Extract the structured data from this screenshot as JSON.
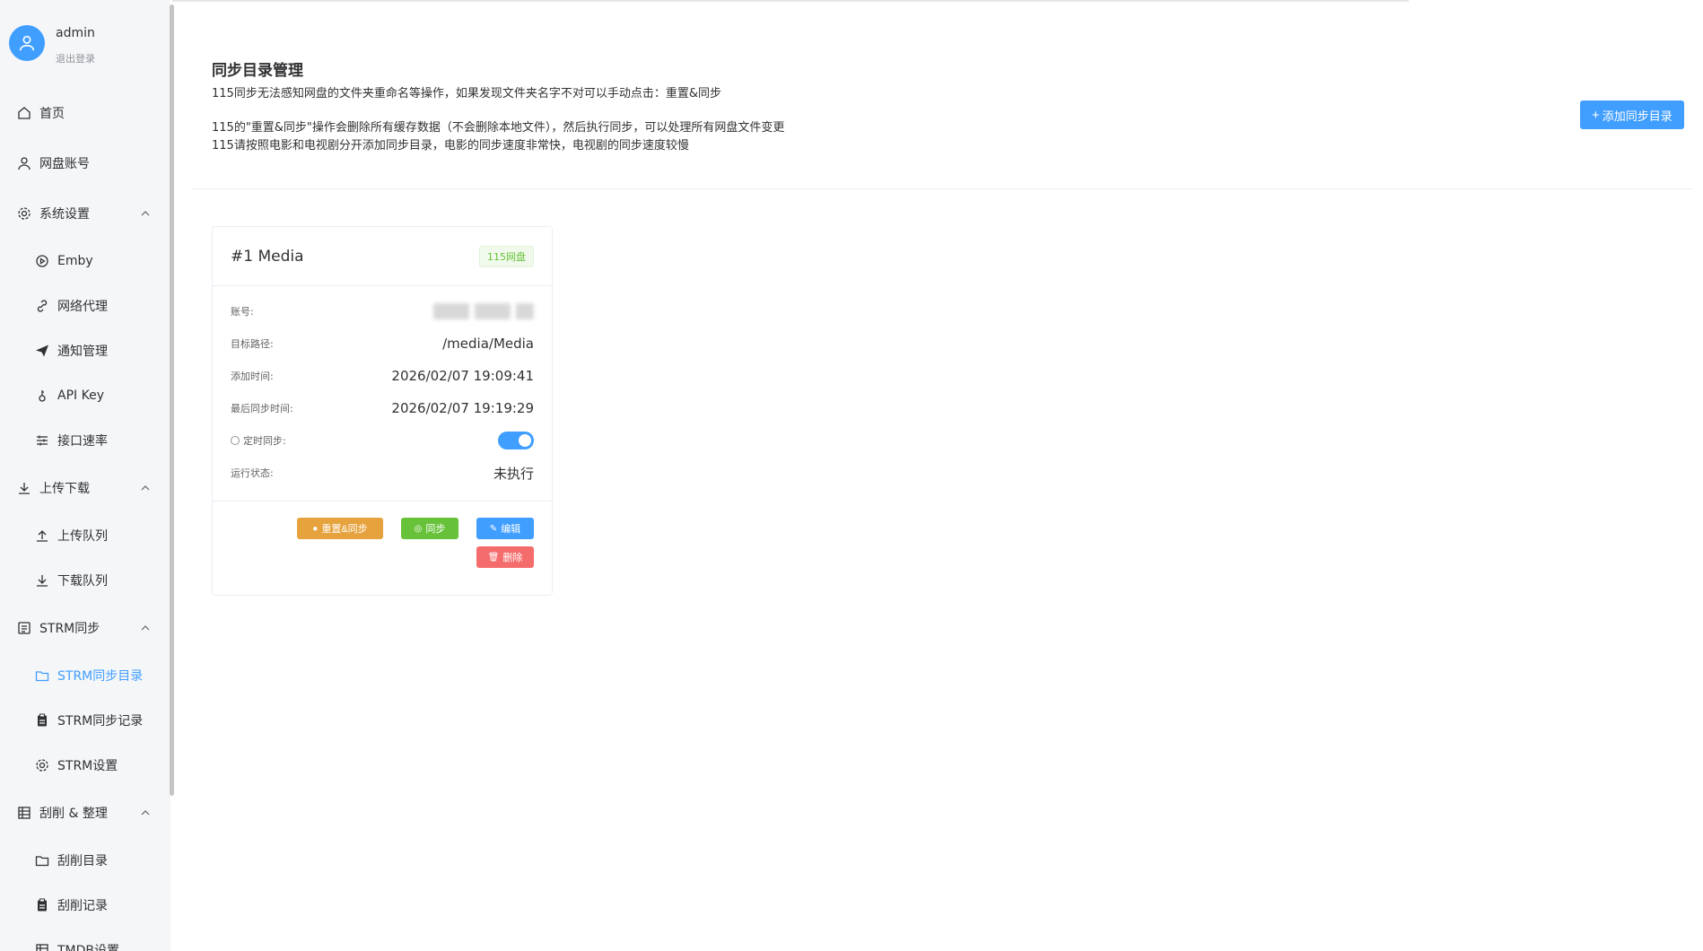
{
  "user": {
    "name": "admin",
    "logout_label": "退出登录"
  },
  "sidebar": {
    "items": [
      {
        "label": "首页",
        "icon": "home-icon",
        "level": 0
      },
      {
        "label": "网盘账号",
        "icon": "user-icon",
        "level": 0
      },
      {
        "label": "系统设置",
        "icon": "gear-icon",
        "level": 0,
        "expanded": true
      },
      {
        "label": "Emby",
        "icon": "play-circle-icon",
        "level": 1
      },
      {
        "label": "网络代理",
        "icon": "link-icon",
        "level": 1
      },
      {
        "label": "通知管理",
        "icon": "send-icon",
        "level": 1
      },
      {
        "label": "API Key",
        "icon": "key-icon",
        "level": 1
      },
      {
        "label": "接口速率",
        "icon": "sliders-icon",
        "level": 1
      },
      {
        "label": "上传下载",
        "icon": "download-icon",
        "level": 0,
        "expanded": true
      },
      {
        "label": "上传队列",
        "icon": "upload-icon",
        "level": 1
      },
      {
        "label": "下载队列",
        "icon": "download-icon",
        "level": 1
      },
      {
        "label": "STRM同步",
        "icon": "document-icon",
        "level": 0,
        "expanded": true
      },
      {
        "label": "STRM同步目录",
        "icon": "folder-icon",
        "level": 1,
        "active": true
      },
      {
        "label": "STRM同步记录",
        "icon": "clipboard-icon",
        "level": 1
      },
      {
        "label": "STRM设置",
        "icon": "gear-icon",
        "level": 1
      },
      {
        "label": "刮削 & 整理",
        "icon": "grid-icon",
        "level": 0,
        "expanded": true
      },
      {
        "label": "刮削目录",
        "icon": "folder-icon",
        "level": 1
      },
      {
        "label": "刮削记录",
        "icon": "clipboard-icon",
        "level": 1
      },
      {
        "label": "TMDB设置",
        "icon": "grid-icon",
        "level": 1
      }
    ]
  },
  "header": {
    "title": "同步目录管理",
    "desc1": "115同步无法感知网盘的文件夹重命名等操作，如果发现文件夹名字不对可以手动点击：重置&同步",
    "desc2": "115的\"重置&同步\"操作会删除所有缓存数据（不会删除本地文件），然后执行同步，可以处理所有网盘文件变更",
    "desc3": "115请按照电影和电视剧分开添加同步目录，电影的同步速度非常快，电视剧的同步速度较慢",
    "add_button": "添加同步目录"
  },
  "card": {
    "title": "#1 Media",
    "tag": "115网盘",
    "account_label": "账号:",
    "path_label": "目标路径:",
    "path_value": "/media/Media",
    "added_label": "添加时间:",
    "added_value": "2026/02/07 19:09:41",
    "last_sync_label": "最后同步时间:",
    "last_sync_value": "2026/02/07 19:19:29",
    "scheduled_label": "定时同步:",
    "scheduled_on": true,
    "status_label": "运行状态:",
    "status_value": "未执行",
    "buttons": {
      "reset_sync": "重置&同步",
      "sync": "同步",
      "edit": "编辑",
      "delete": "删除"
    }
  },
  "colors": {
    "primary": "#409eff",
    "success": "#67c23a",
    "warning": "#e6a23c",
    "danger": "#f56c6c"
  }
}
